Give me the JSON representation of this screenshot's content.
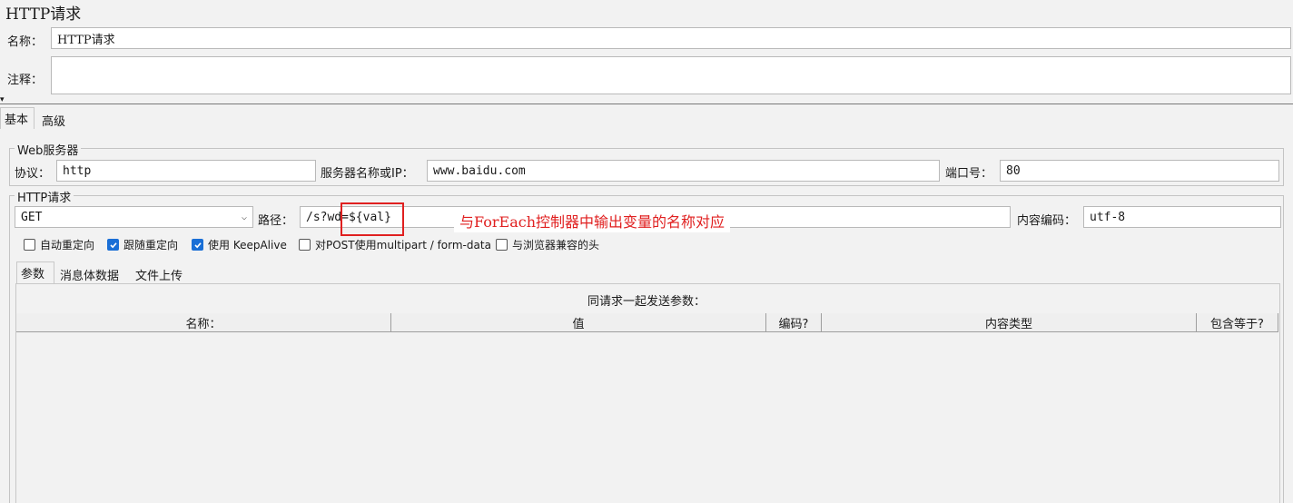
{
  "window": {
    "title": "HTTP请求"
  },
  "form": {
    "name_label": "名称：",
    "name_value": "HTTP请求",
    "comment_label": "注释：",
    "comment_value": ""
  },
  "tabs": [
    "基本",
    "高级"
  ],
  "web_server": {
    "legend": "Web服务器",
    "protocol_label": "协议：",
    "protocol_value": "http",
    "server_label": "服务器名称或IP：",
    "server_value": "www.baidu.com",
    "port_label": "端口号：",
    "port_value": "80"
  },
  "http_request": {
    "legend": "HTTP请求",
    "method": "GET",
    "path_label": "路径：",
    "path_value": "/s?wd=${val}",
    "encoding_label": "内容编码：",
    "encoding_value": "utf-8"
  },
  "options": [
    {
      "label": "自动重定向",
      "checked": false
    },
    {
      "label": "跟随重定向",
      "checked": true
    },
    {
      "label": "使用 KeepAlive",
      "checked": true
    },
    {
      "label": "对POST使用multipart / form-data",
      "checked": false
    },
    {
      "label": "与浏览器兼容的头",
      "checked": false
    }
  ],
  "sub_tabs": [
    "参数",
    "消息体数据",
    "文件上传"
  ],
  "params": {
    "caption": "同请求一起发送参数：",
    "columns": [
      "名称：",
      "值",
      "编码?",
      "内容类型",
      "包含等于?"
    ]
  },
  "annotation": {
    "text": "与ForEach控制器中输出变量的名称对应",
    "color": "#e02020"
  },
  "colors": {
    "checkbox_accent": "#1a6fd6"
  }
}
